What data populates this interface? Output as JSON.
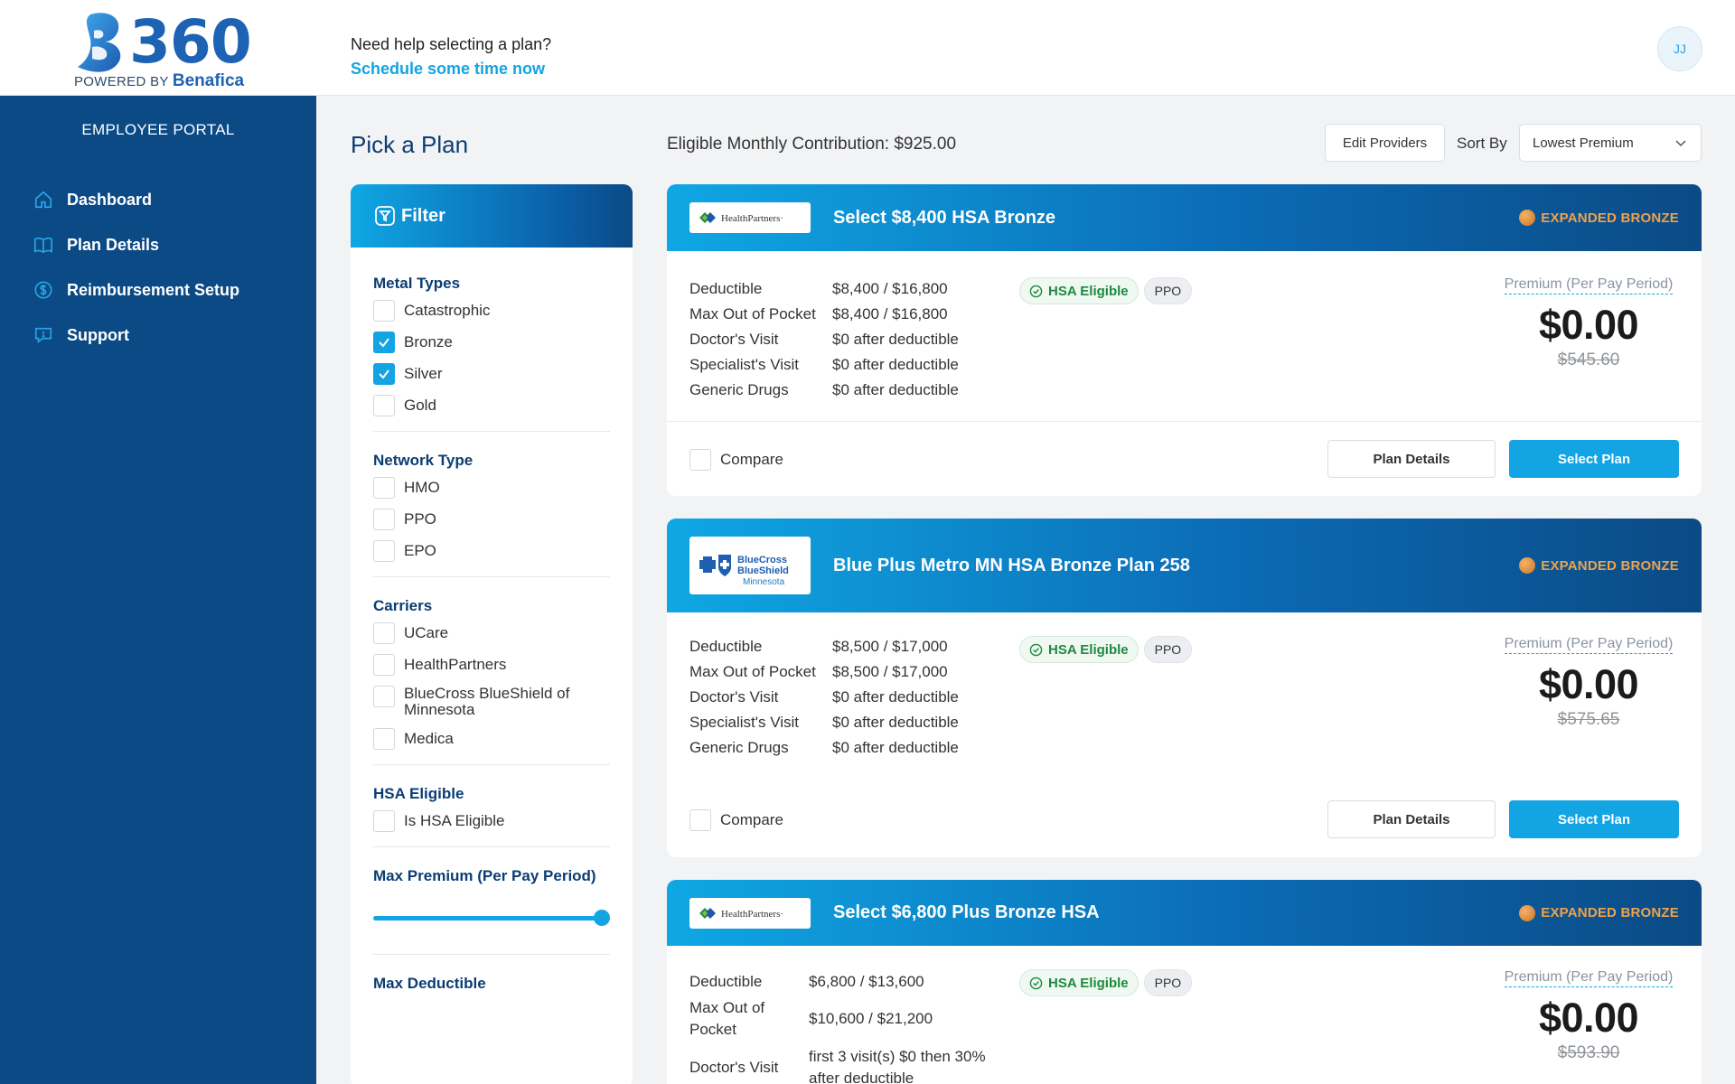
{
  "header": {
    "brand_number": "360",
    "powered_by": "POWERED BY",
    "powered_brand": "Benafica",
    "help_question": "Need help selecting a plan?",
    "help_link": "Schedule some time now",
    "avatar_initials": "JJ"
  },
  "sidebar": {
    "portal_title": "EMPLOYEE PORTAL",
    "items": [
      {
        "label": "Dashboard",
        "icon": "home-icon"
      },
      {
        "label": "Plan Details",
        "icon": "book-icon"
      },
      {
        "label": "Reimbursement Setup",
        "icon": "dollar-circle-icon"
      },
      {
        "label": "Support",
        "icon": "chat-icon"
      }
    ]
  },
  "main": {
    "title": "Pick a Plan",
    "contribution": "Eligible Monthly Contribution: $925.00",
    "edit_providers": "Edit Providers",
    "sort_by_label": "Sort By",
    "sort_value": "Lowest Premium"
  },
  "filter": {
    "title": "Filter",
    "metal_types": {
      "title": "Metal Types",
      "options": [
        {
          "label": "Catastrophic",
          "checked": false
        },
        {
          "label": "Bronze",
          "checked": true
        },
        {
          "label": "Silver",
          "checked": true
        },
        {
          "label": "Gold",
          "checked": false
        }
      ]
    },
    "network_type": {
      "title": "Network Type",
      "options": [
        {
          "label": "HMO",
          "checked": false
        },
        {
          "label": "PPO",
          "checked": false
        },
        {
          "label": "EPO",
          "checked": false
        }
      ]
    },
    "carriers": {
      "title": "Carriers",
      "options": [
        {
          "label": "UCare",
          "checked": false
        },
        {
          "label": "HealthPartners",
          "checked": false
        },
        {
          "label": "BlueCross BlueShield of Minnesota",
          "checked": false
        },
        {
          "label": "Medica",
          "checked": false
        }
      ]
    },
    "hsa": {
      "title": "HSA Eligible",
      "options": [
        {
          "label": "Is HSA Eligible",
          "checked": false
        }
      ]
    },
    "max_premium": {
      "title": "Max Premium (Per Pay Period)",
      "value_fraction": 1.0
    },
    "max_deductible": {
      "title": "Max Deductible"
    }
  },
  "plans": [
    {
      "carrier_logo": "HealthPartners",
      "carrier_logo_text": "HealthPartners·",
      "name": "Select $8,400 HSA Bronze",
      "metal": "EXPANDED BRONZE",
      "rows": [
        {
          "k": "Deductible",
          "v": "$8,400 / $16,800"
        },
        {
          "k": "Max Out of Pocket",
          "v": "$8,400 / $16,800"
        },
        {
          "k": "Doctor's Visit",
          "v": "$0 after deductible"
        },
        {
          "k": "Specialist's Visit",
          "v": "$0 after deductible"
        },
        {
          "k": "Generic Drugs",
          "v": "$0 after deductible"
        }
      ],
      "hsa_badge": "HSA Eligible",
      "network_badge": "PPO",
      "premium_label": "Premium (Per Pay Period)",
      "premium": "$0.00",
      "original_premium": "$545.60",
      "compare_label": "Compare",
      "details_label": "Plan Details",
      "select_label": "Select Plan"
    },
    {
      "carrier_logo": "BlueCross BlueShield Minnesota",
      "carrier_logo_line1": "BlueCross",
      "carrier_logo_line2": "BlueShield",
      "carrier_logo_line3": "Minnesota",
      "name": "Blue Plus Metro MN HSA Bronze Plan 258",
      "metal": "EXPANDED BRONZE",
      "rows": [
        {
          "k": "Deductible",
          "v": "$8,500 / $17,000"
        },
        {
          "k": "Max Out of Pocket",
          "v": "$8,500 / $17,000"
        },
        {
          "k": "Doctor's Visit",
          "v": "$0 after deductible"
        },
        {
          "k": "Specialist's Visit",
          "v": "$0 after deductible"
        },
        {
          "k": "Generic Drugs",
          "v": "$0 after deductible"
        }
      ],
      "hsa_badge": "HSA Eligible",
      "network_badge": "PPO",
      "premium_label": "Premium (Per Pay Period)",
      "premium": "$0.00",
      "original_premium": "$575.65",
      "compare_label": "Compare",
      "details_label": "Plan Details",
      "select_label": "Select Plan"
    },
    {
      "carrier_logo": "HealthPartners",
      "carrier_logo_text": "HealthPartners·",
      "name": "Select $6,800 Plus Bronze HSA",
      "metal": "EXPANDED BRONZE",
      "rows": [
        {
          "k": "Deductible",
          "v": "$6,800 / $13,600"
        },
        {
          "k": "Max Out of Pocket",
          "v": "$10,600 / $21,200"
        },
        {
          "k": "Doctor's Visit",
          "v": "first 3 visit(s) $0 then 30% after deductible"
        }
      ],
      "hsa_badge": "HSA Eligible",
      "network_badge": "PPO",
      "premium_label": "Premium (Per Pay Period)",
      "premium": "$0.00",
      "original_premium": "$593.90"
    }
  ],
  "colors": {
    "sidebar": "#0b4a84",
    "accent": "#12a4e3",
    "bronze": "#f0a24a"
  }
}
